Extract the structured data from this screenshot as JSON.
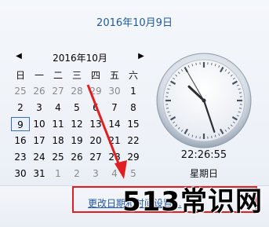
{
  "header": {
    "date_text": "2016年10月9日"
  },
  "calendar": {
    "month_title": "2016年10月",
    "prev_glyph": "◀",
    "next_glyph": "▶",
    "weekdays": [
      "日",
      "一",
      "二",
      "三",
      "四",
      "五",
      "六"
    ],
    "rows": [
      [
        "25",
        "26",
        "27",
        "28",
        "29",
        "30",
        "1"
      ],
      [
        "2",
        "3",
        "4",
        "5",
        "6",
        "7",
        "8"
      ],
      [
        "9",
        "10",
        "11",
        "12",
        "13",
        "14",
        "15"
      ],
      [
        "16",
        "17",
        "18",
        "19",
        "20",
        "21",
        "22"
      ],
      [
        "23",
        "24",
        "25",
        "26",
        "27",
        "28",
        "29"
      ],
      [
        "30",
        "31",
        "1",
        "2",
        "3",
        "4",
        "5"
      ]
    ],
    "selected_day": "9"
  },
  "clock": {
    "time_text": "22:26:55",
    "weekday_text": "星期日",
    "hour": 22,
    "minute": 26,
    "second": 55
  },
  "footer": {
    "link_label": "更改日期和时间设置..."
  },
  "watermark": {
    "text": "513常识网"
  },
  "colors": {
    "header_text": "#1f5a9a",
    "link": "#2356a8",
    "annotation_red": "#e02020"
  }
}
